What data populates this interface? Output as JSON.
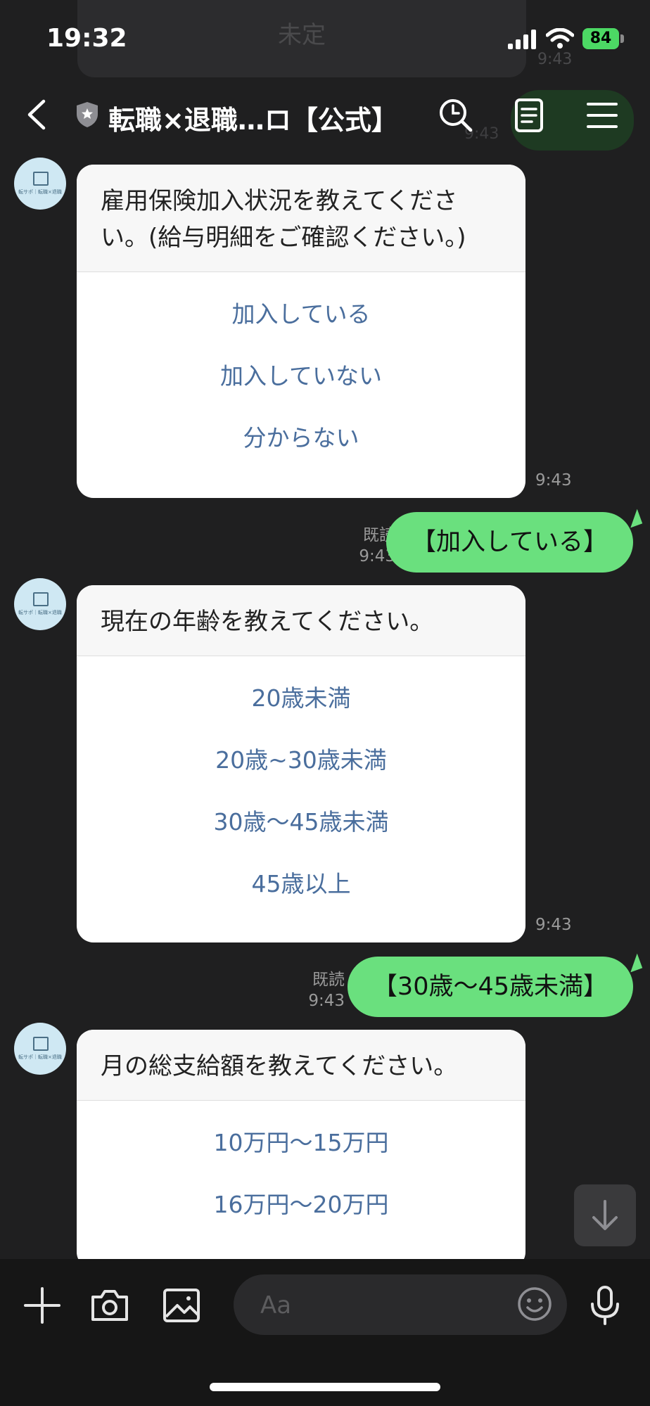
{
  "status_bar": {
    "time": "19:32",
    "battery": "84"
  },
  "background": {
    "ghost_text": "未定",
    "ghost_time": "9:43",
    "ghost_time_2": "9:43"
  },
  "header": {
    "title": "転職×退職…ロ【公式】"
  },
  "avatar": {
    "caption": "転サポ｜転職×退職"
  },
  "messages": [
    {
      "question": "雇用保険加入状況を教えてください。(給与明細をご確認ください。)",
      "options": [
        "加入している",
        "加入していない",
        "分からない"
      ],
      "time": "9:43"
    },
    {
      "reply": "【加入している】",
      "read": "既読",
      "time": "9:43"
    },
    {
      "question": "現在の年齢を教えてください。",
      "options": [
        "20歳未満",
        "20歳~30歳未満",
        "30歳〜45歳未満",
        "45歳以上"
      ],
      "time": "9:43"
    },
    {
      "reply": "【30歳〜45歳未満】",
      "read": "既読",
      "time": "9:43"
    },
    {
      "question": "月の総支給額を教えてください。",
      "options": [
        "10万円〜15万円",
        "16万円〜20万円"
      ]
    }
  ],
  "input": {
    "placeholder": "Aa"
  },
  "colors": {
    "accent_green": "#6ae07e",
    "option_blue": "#4a6e9d",
    "background": "#1f1f20"
  }
}
